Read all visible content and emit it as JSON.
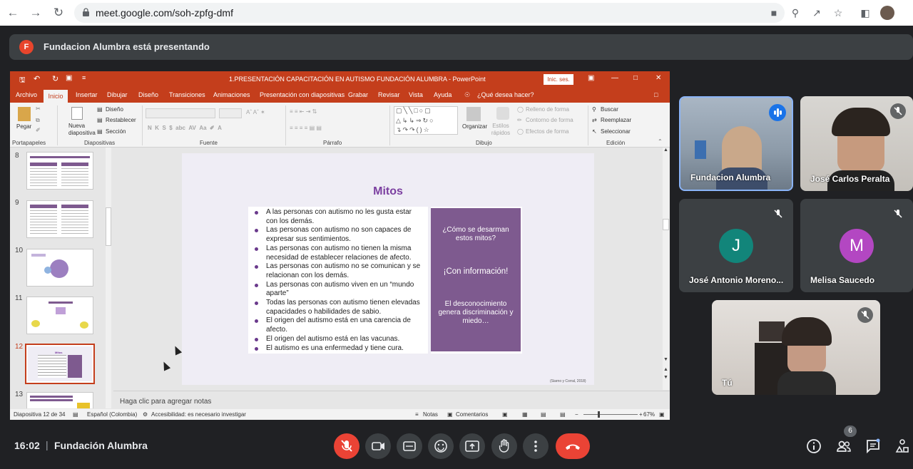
{
  "browser": {
    "url": "meet.google.com/soh-zpfg-dmf"
  },
  "presenting_banner": {
    "avatar_letter": "F",
    "text": "Fundacion Alumbra está presentando"
  },
  "powerpoint": {
    "window_title": "1.PRESENTACIÓN CAPACITACIÓN EN AUTISMO FUNDACIÓN ALUMBRA  -  PowerPoint",
    "signin_label": "Inic. ses.",
    "menu_tabs": [
      "Archivo",
      "Inicio",
      "Insertar",
      "Dibujar",
      "Diseño",
      "Transiciones",
      "Animaciones",
      "Presentación con diapositivas",
      "Grabar",
      "Revisar",
      "Vista",
      "Ayuda"
    ],
    "tell_me": "¿Qué desea hacer?",
    "ribbon": {
      "pegar": "Pegar",
      "nueva_diapositiva": "Nueva diapositiva",
      "diseno": "Diseño",
      "restablecer": "Restablecer",
      "seccion": "Sección",
      "organizar": "Organizar",
      "estilos_rapidos": "Estilos rápidos",
      "relleno": "Relleno de forma",
      "contorno": "Contorno de forma",
      "efectos": "Efectos de forma",
      "buscar": "Buscar",
      "reemplazar": "Reemplazar",
      "seleccionar": "Seleccionar",
      "groups": [
        "Portapapeles",
        "Diapositivas",
        "Fuente",
        "Párrafo",
        "Dibujo",
        "Edición"
      ]
    },
    "thumbnails": [
      {
        "num": "8",
        "selected": false
      },
      {
        "num": "9",
        "selected": false
      },
      {
        "num": "10",
        "selected": false
      },
      {
        "num": "11",
        "selected": false
      },
      {
        "num": "12",
        "selected": true,
        "title": "Mitos"
      },
      {
        "num": "13",
        "selected": false
      }
    ],
    "slide": {
      "title": "Mitos",
      "bullets": [
        "A las personas con autismo no les gusta estar con los demás.",
        "Las personas con  autismo no  son capaces de expresar sus sentimientos.",
        "Las personas con autismo no tienen la misma necesidad de establecer relaciones de afecto.",
        "Las personas con autismo no se comunican y se relacionan con los demás.",
        "Las personas con autismo  viven en un “mundo aparte”",
        "Todas las personas con autismo tienen elevadas capacidades o habilidades de sabio.",
        "El origen del autismo está en una carencia de afecto.",
        "El origen del autismo está en las vacunas.",
        "El autismo es una enfermedad y tiene cura."
      ],
      "box_question": "¿Cómo se desarman estos mitos?",
      "box_answer": "¡Con información!",
      "box_note": "El desconocimiento genera discriminación y miedo…",
      "citation": "(Siarno y Corral, 2018)",
      "box_color": "#7e5a8f",
      "title_color": "#7b3fa0"
    },
    "notes_placeholder": "Haga clic para agregar notas",
    "status": {
      "slide_counter": "Diapositiva 12 de 34",
      "language": "Español (Colombia)",
      "accessibility": "Accesibilidad: es necesario investigar",
      "notes": "Notas",
      "comments": "Comentarios",
      "zoom": "67%"
    },
    "accent_color": "#c43e1c"
  },
  "participants": [
    {
      "name": "Fundacion Alumbra",
      "speaking": true
    },
    {
      "name": "José Carlos Peralta",
      "muted": true
    },
    {
      "name": "José Antonio Moreno...",
      "letter": "J",
      "avatar_color": "#12857a",
      "muted": true
    },
    {
      "name": "Melisa Saucedo",
      "letter": "M",
      "avatar_color": "#b347c2",
      "muted": true
    },
    {
      "name": "Tú",
      "muted": true
    }
  ],
  "bottom_bar": {
    "time": "16:02",
    "meeting_name": "Fundación Alumbra",
    "participant_count": "6",
    "hangup_color": "#ea4335"
  }
}
